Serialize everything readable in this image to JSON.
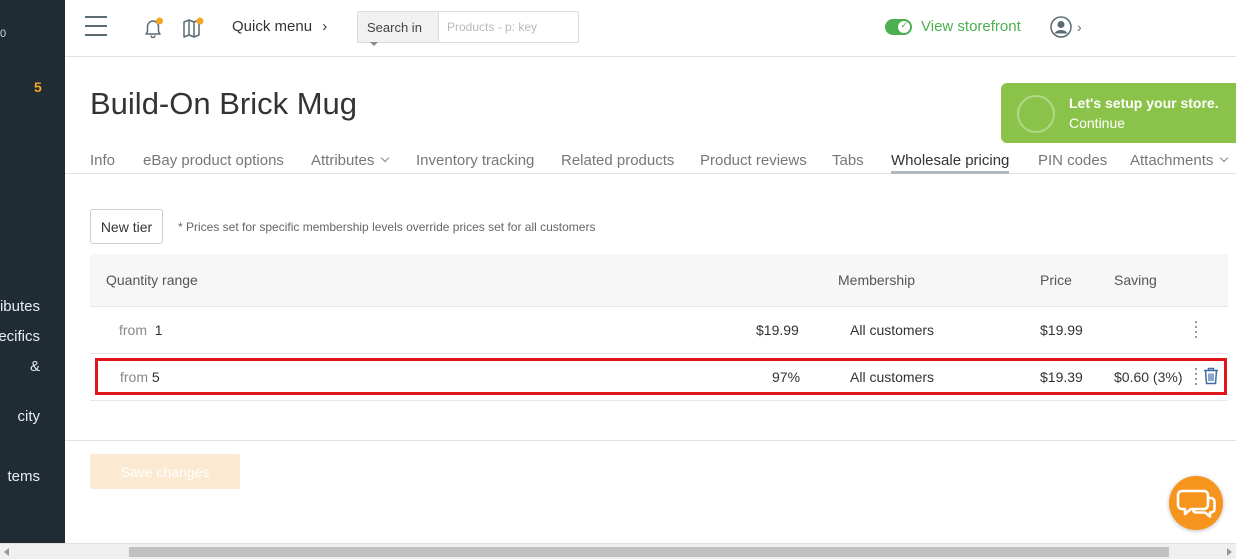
{
  "sidebar": {
    "top_digit": "0",
    "badge_count": "5",
    "items": [
      {
        "label": "ributes"
      },
      {
        "label": "ecifics"
      },
      {
        "label": "&"
      },
      {
        "label": "city"
      },
      {
        "label": "tems"
      }
    ]
  },
  "header": {
    "quick_menu": "Quick menu",
    "search_scope": "Search in",
    "search_placeholder": "Products - p: key",
    "storefront_label": "View storefront",
    "storefront_enabled": true,
    "accent_color": "#4caf50",
    "notification_dot_color": "#f5a623"
  },
  "page": {
    "title": "Build-On Brick Mug"
  },
  "setup": {
    "title": "Let's setup your store.",
    "action": "Continue",
    "color": "#8bc34a"
  },
  "tabs": [
    {
      "label": "Info",
      "active": false
    },
    {
      "label": "eBay product options",
      "active": false
    },
    {
      "label": "Attributes",
      "active": false,
      "dropdown": true
    },
    {
      "label": "Inventory tracking",
      "active": false
    },
    {
      "label": "Related products",
      "active": false
    },
    {
      "label": "Product reviews",
      "active": false
    },
    {
      "label": "Tabs",
      "active": false
    },
    {
      "label": "Wholesale pricing",
      "active": true
    },
    {
      "label": "PIN codes",
      "active": false
    },
    {
      "label": "Attachments",
      "active": false,
      "dropdown": true
    }
  ],
  "toolbar": {
    "new_tier": "New tier",
    "note": "* Prices set for specific membership levels override prices set for all customers"
  },
  "table": {
    "columns": {
      "quantity_range": "Quantity range",
      "membership": "Membership",
      "price": "Price",
      "saving": "Saving"
    },
    "rows": [
      {
        "from_label": "from",
        "quantity": "1",
        "value": "$19.99",
        "membership": "All customers",
        "price": "$19.99",
        "saving": ""
      },
      {
        "from_label": "from",
        "quantity": "5",
        "value": "97%",
        "membership": "All customers",
        "price": "$19.39",
        "saving": "$0.60 (3%)"
      }
    ],
    "highlight_color": "#e2151b"
  },
  "footer": {
    "save_label": "Save changes"
  },
  "chat": {
    "color": "#f7941d",
    "icon": "chat-bubbles-icon"
  }
}
